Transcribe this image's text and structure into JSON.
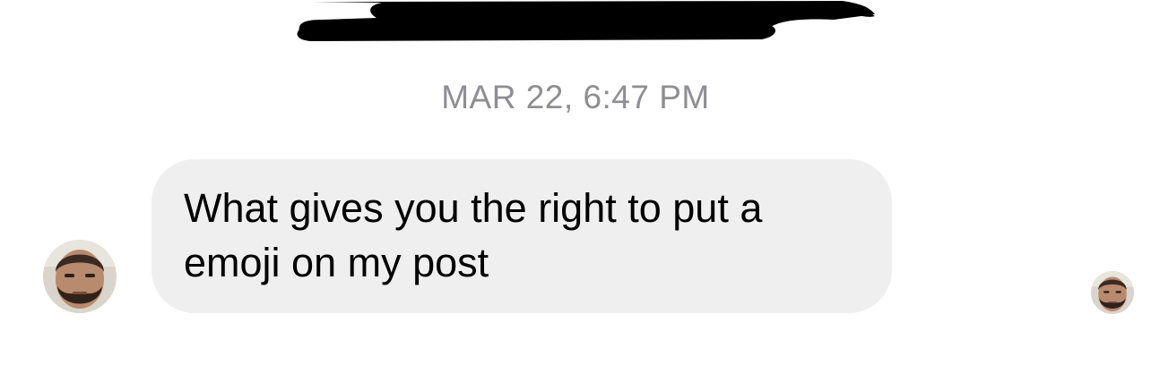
{
  "thread": {
    "timestamp": "MAR 22, 6:47 PM"
  },
  "messages": [
    {
      "direction": "incoming",
      "text": "What gives you the right to put a emoji on my post",
      "bubble_color": "#efefef",
      "avatar_icon": "avatar-photo"
    }
  ],
  "read_receipt": {
    "avatar_icon": "avatar-photo"
  },
  "colors": {
    "background": "#ffffff",
    "timestamp_text": "#8e8e93",
    "message_text": "#000000",
    "redaction": "#000000"
  }
}
